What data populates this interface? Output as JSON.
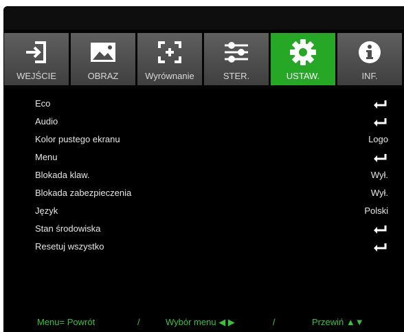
{
  "tabs": [
    {
      "label": "WEJŚCIE",
      "icon": "input-icon",
      "active": false
    },
    {
      "label": "OBRAZ",
      "icon": "image-icon",
      "active": false
    },
    {
      "label": "Wyrównanie",
      "icon": "alignment-icon",
      "active": false
    },
    {
      "label": "STER.",
      "icon": "sliders-icon",
      "active": false
    },
    {
      "label": "USTAW.",
      "icon": "gear-icon",
      "active": true
    },
    {
      "label": "INF.",
      "icon": "info-icon",
      "active": false
    }
  ],
  "items": [
    {
      "name": "Eco",
      "value": "",
      "enter": true
    },
    {
      "name": "Audio",
      "value": "",
      "enter": true
    },
    {
      "name": "Kolor pustego ekranu",
      "value": "Logo",
      "enter": false
    },
    {
      "name": "Menu",
      "value": "",
      "enter": true
    },
    {
      "name": "Blokada klaw.",
      "value": "Wył.",
      "enter": false
    },
    {
      "name": "Blokada zabezpieczenia",
      "value": "Wył.",
      "enter": false
    },
    {
      "name": "Język",
      "value": "Polski",
      "enter": false
    },
    {
      "name": "Stan środowiska",
      "value": "",
      "enter": true
    },
    {
      "name": "Resetuj wszystko",
      "value": "",
      "enter": true
    }
  ],
  "footer": {
    "back": "Menu= Powrót",
    "sep1": "/",
    "select": "Wybór menu ◀ ▶",
    "sep2": "/",
    "scroll": "Przewiń ▲▼"
  },
  "colors": {
    "active_tab": "#26a826",
    "footer_text": "#38c23b",
    "background": "#000000"
  }
}
